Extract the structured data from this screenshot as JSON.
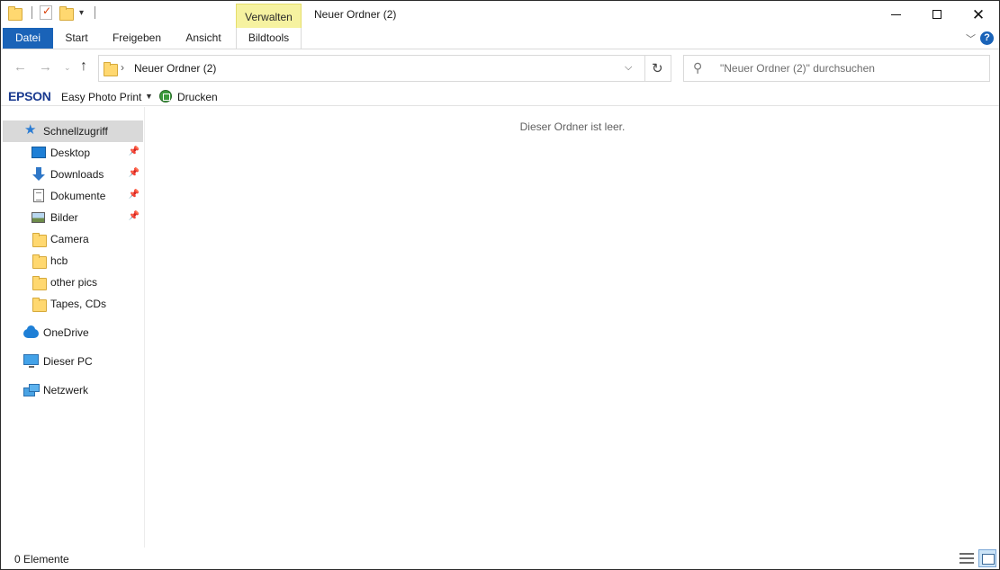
{
  "window": {
    "title": "Neuer Ordner (2)",
    "context_tab_group": "Verwalten"
  },
  "ribbon": {
    "tabs": [
      "Datei",
      "Start",
      "Freigeben",
      "Ansicht",
      "Bildtools"
    ],
    "accent": "#1a63b8",
    "context_color": "#f6f2a0"
  },
  "address": {
    "breadcrumb": "Neuer Ordner (2)",
    "search_placeholder": "\"Neuer Ordner (2)\" durchsuchen"
  },
  "epson_bar": {
    "brand": "EPSON",
    "app": "Easy Photo Print",
    "print_label": "Drucken"
  },
  "nav": {
    "quick_access": "Schnellzugriff",
    "pinned": [
      {
        "label": "Desktop",
        "icon": "desktop-icon"
      },
      {
        "label": "Downloads",
        "icon": "downloads-icon"
      },
      {
        "label": "Dokumente",
        "icon": "documents-icon"
      },
      {
        "label": "Bilder",
        "icon": "pictures-icon"
      }
    ],
    "folders": [
      "Camera",
      "hcb",
      "other pics",
      "Tapes, CDs"
    ],
    "roots": [
      {
        "label": "OneDrive",
        "icon": "onedrive-icon"
      },
      {
        "label": "Dieser PC",
        "icon": "this-pc-icon"
      },
      {
        "label": "Netzwerk",
        "icon": "network-icon"
      }
    ]
  },
  "content": {
    "empty_message": "Dieser Ordner ist leer."
  },
  "status": {
    "item_count": "0 Elemente"
  }
}
